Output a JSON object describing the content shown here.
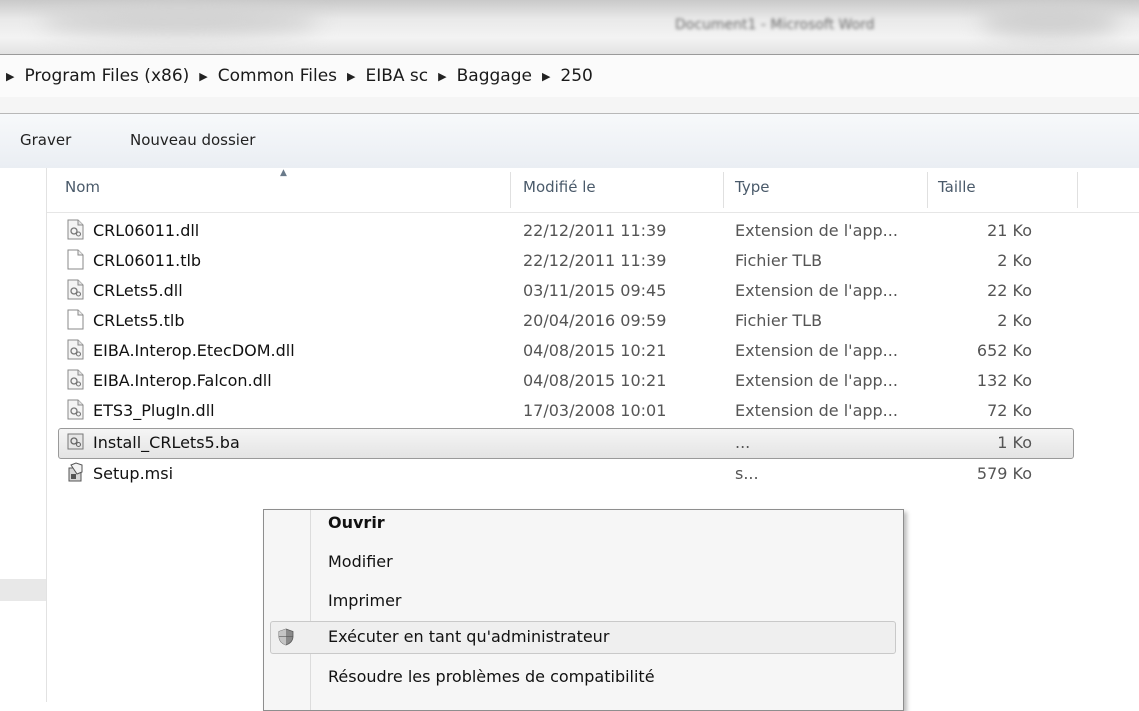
{
  "window": {
    "title": "Document1 - Microsoft Word"
  },
  "address": {
    "breadcrumb": [
      "Program Files (x86)",
      "Common Files",
      "EIBA sc",
      "Baggage",
      "250"
    ]
  },
  "toolbar": {
    "burn_label": "Graver",
    "new_folder_label": "Nouveau dossier"
  },
  "columns": {
    "name": "Nom",
    "modified": "Modifié le",
    "type": "Type",
    "size": "Taille"
  },
  "files": [
    {
      "name": "CRL06011.dll",
      "modified": "22/12/2011 11:39",
      "type": "Extension de l'app...",
      "size": "21 Ko",
      "icon": "dll-icon"
    },
    {
      "name": "CRL06011.tlb",
      "modified": "22/12/2011 11:39",
      "type": "Fichier TLB",
      "size": "2 Ko",
      "icon": "file-icon"
    },
    {
      "name": "CRLets5.dll",
      "modified": "03/11/2015 09:45",
      "type": "Extension de l'app...",
      "size": "22 Ko",
      "icon": "dll-icon"
    },
    {
      "name": "CRLets5.tlb",
      "modified": "20/04/2016 09:59",
      "type": "Fichier TLB",
      "size": "2 Ko",
      "icon": "file-icon"
    },
    {
      "name": "EIBA.Interop.EtecDOM.dll",
      "modified": "04/08/2015 10:21",
      "type": "Extension de l'app...",
      "size": "652 Ko",
      "icon": "dll-icon"
    },
    {
      "name": "EIBA.Interop.Falcon.dll",
      "modified": "04/08/2015 10:21",
      "type": "Extension de l'app...",
      "size": "132 Ko",
      "icon": "dll-icon"
    },
    {
      "name": "ETS3_PlugIn.dll",
      "modified": "17/03/2008 10:01",
      "type": "Extension de l'app...",
      "size": "72 Ko",
      "icon": "dll-icon"
    },
    {
      "name": "Install_CRLets5.ba",
      "modified": "",
      "type": "...",
      "size": "1 Ko",
      "icon": "batch-icon",
      "selected": true
    },
    {
      "name": "Setup.msi",
      "modified": "",
      "type": "s...",
      "size": "579 Ko",
      "icon": "msi-icon"
    }
  ],
  "context_menu": {
    "items": [
      {
        "label": "Ouvrir",
        "default": true
      },
      {
        "label": "Modifier"
      },
      {
        "label": "Imprimer"
      },
      {
        "label": "Exécuter en tant qu'administrateur",
        "icon": "shield-icon",
        "highlighted": true
      },
      {
        "label": "Résoudre les problèmes de compatibilité"
      }
    ]
  }
}
